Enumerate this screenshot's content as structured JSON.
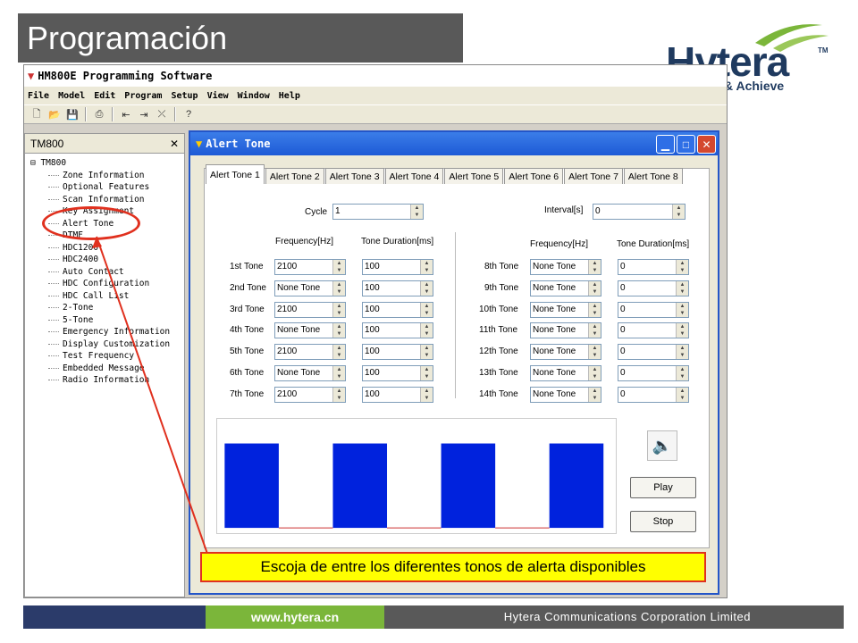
{
  "slide": {
    "title": "Programación",
    "logo_word": "Hytera",
    "logo_tm": "TM",
    "logo_tagline": "& Achieve",
    "callout": "Escoja de entre los diferentes tonos de alerta disponibles",
    "footer_url": "www.hytera.cn",
    "footer_company": "Hytera Communications Corporation Limited"
  },
  "app": {
    "title": "HM800E Programming Software",
    "menu": [
      "File",
      "Model",
      "Edit",
      "Program",
      "Setup",
      "View",
      "Window",
      "Help"
    ],
    "toolbar_icons": [
      "new-file-icon",
      "open-folder-icon",
      "save-icon",
      "print-icon",
      "read-radio-icon",
      "write-radio-icon",
      "disconnect-icon",
      "help-icon"
    ]
  },
  "tree": {
    "header": "TM800",
    "close_glyph": "✕",
    "root": "TM800",
    "items": [
      "Zone Information",
      "Optional Features",
      "Scan Information",
      "Key Assignment",
      "Alert Tone",
      "DTMF",
      "HDC1200",
      "HDC2400",
      "Auto Contact",
      "HDC Configuration",
      "HDC Call List",
      "2-Tone",
      "5-Tone",
      "Emergency Information",
      "Display Customization",
      "Test Frequency",
      "Embedded Message",
      "Radio Information"
    ]
  },
  "dialog": {
    "title": "Alert Tone",
    "tabs": [
      "Alert Tone 1",
      "Alert Tone 2",
      "Alert Tone 3",
      "Alert Tone 4",
      "Alert Tone 5",
      "Alert Tone 6",
      "Alert Tone 7",
      "Alert Tone 8"
    ],
    "cycle_label": "Cycle",
    "cycle_value": "1",
    "interval_label": "Interval[s]",
    "interval_value": "0",
    "freq_header": "Frequency[Hz]",
    "dur_header": "Tone Duration[ms]",
    "left_tones": [
      {
        "label": "1st Tone",
        "freq": "2100",
        "dur": "100"
      },
      {
        "label": "2nd Tone",
        "freq": "None Tone",
        "dur": "100"
      },
      {
        "label": "3rd Tone",
        "freq": "2100",
        "dur": "100"
      },
      {
        "label": "4th Tone",
        "freq": "None Tone",
        "dur": "100"
      },
      {
        "label": "5th Tone",
        "freq": "2100",
        "dur": "100"
      },
      {
        "label": "6th Tone",
        "freq": "None Tone",
        "dur": "100"
      },
      {
        "label": "7th Tone",
        "freq": "2100",
        "dur": "100"
      }
    ],
    "right_tones": [
      {
        "label": "8th Tone",
        "freq": "None Tone",
        "dur": "0"
      },
      {
        "label": "9th Tone",
        "freq": "None Tone",
        "dur": "0"
      },
      {
        "label": "10th Tone",
        "freq": "None Tone",
        "dur": "0"
      },
      {
        "label": "11th Tone",
        "freq": "None Tone",
        "dur": "0"
      },
      {
        "label": "12th Tone",
        "freq": "None Tone",
        "dur": "0"
      },
      {
        "label": "13th Tone",
        "freq": "None Tone",
        "dur": "0"
      },
      {
        "label": "14th Tone",
        "freq": "None Tone",
        "dur": "0"
      }
    ],
    "play_label": "Play",
    "stop_label": "Stop",
    "waveform_color": "#0022dd"
  },
  "colors": {
    "accent_red": "#e0301e",
    "callout_bg": "#ffff00",
    "footer_green": "#7bb63a",
    "footer_navy": "#2b3b6a"
  }
}
